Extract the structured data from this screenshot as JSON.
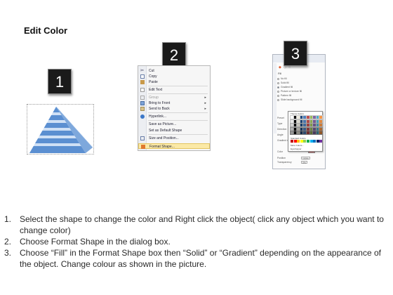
{
  "title": "Edit Color",
  "steps": {
    "one": "1",
    "two": "2",
    "three": "3"
  },
  "context_menu": {
    "items": [
      {
        "label": "Cut",
        "icon": "scissors-icon",
        "submenu": false
      },
      {
        "label": "Copy",
        "icon": "copy-icon",
        "submenu": false
      },
      {
        "label": "Paste",
        "icon": "paste-icon",
        "submenu": false
      },
      {
        "label": "Edit Text",
        "icon": "edit-text-icon",
        "submenu": false
      },
      {
        "label": "Group",
        "icon": "group-icon",
        "submenu": true
      },
      {
        "label": "Bring to Front",
        "icon": "bring-to-front-icon",
        "submenu": true
      },
      {
        "label": "Send to Back",
        "icon": "send-to-back-icon",
        "submenu": true
      },
      {
        "label": "Hyperlink...",
        "icon": "hyperlink-icon",
        "submenu": false
      },
      {
        "label": "Save as Picture...",
        "icon": "picture-icon",
        "submenu": false
      },
      {
        "label": "Set as Default Shape",
        "icon": "default-shape-icon",
        "submenu": false
      },
      {
        "label": "Size and Position...",
        "icon": "size-icon",
        "submenu": false
      },
      {
        "label": "Format Shape...",
        "icon": "format-shape-icon",
        "submenu": false,
        "highlighted": true
      }
    ]
  },
  "dialog": {
    "fill_header": "Fill",
    "options": [
      "No fill",
      "Solid fill",
      "Gradient fill",
      "Picture or texture fill",
      "Pattern fill",
      "Slide background fill"
    ],
    "fields": [
      "Preset",
      "Type",
      "Direction",
      "Angle",
      "Gradient stops",
      "Color",
      "Position",
      "Transparency"
    ],
    "position_value": "100%",
    "transparency_value": "0%"
  },
  "palette": {
    "theme_label": "Theme Colors",
    "standard_label": "Standard Colors",
    "more_label": "More Colors...",
    "eyedropper_label": "Eyedropper"
  },
  "instructions": [
    {
      "num": "1.",
      "text": "Select the shape to change the color and Right click the object( click any object which you want to change color)"
    },
    {
      "num": "2.",
      "text": "Choose Format Shape in the dialog box."
    },
    {
      "num": "3.",
      "text": "Choose “Fill” in the Format Shape box then “Solid” or “Gradient” depending on the appearance of the object. Change colour as shown in the picture."
    }
  ],
  "colors": {
    "pyramid_dark": "#5b8fd1",
    "pyramid_light": "#cfe0f5",
    "highlight": "#fbe9a6"
  }
}
